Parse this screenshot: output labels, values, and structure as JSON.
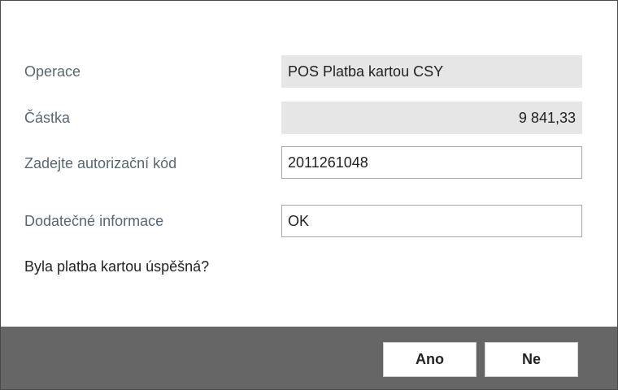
{
  "form": {
    "operation": {
      "label": "Operace",
      "value": "POS Platba kartou CSY"
    },
    "amount": {
      "label": "Částka",
      "value": "9 841,33"
    },
    "auth_code": {
      "label": "Zadejte autorizační kód",
      "value": "2011261048"
    },
    "additional_info": {
      "label": "Dodatečné informace",
      "value": "OK"
    }
  },
  "question": "Byla platba kartou úspěšná?",
  "buttons": {
    "yes_label": "Ano",
    "no_label": "Ne"
  },
  "colors": {
    "footer_background": "#666666",
    "readonly_field_background": "#e6e6e6",
    "label_text": "#5a6570"
  }
}
